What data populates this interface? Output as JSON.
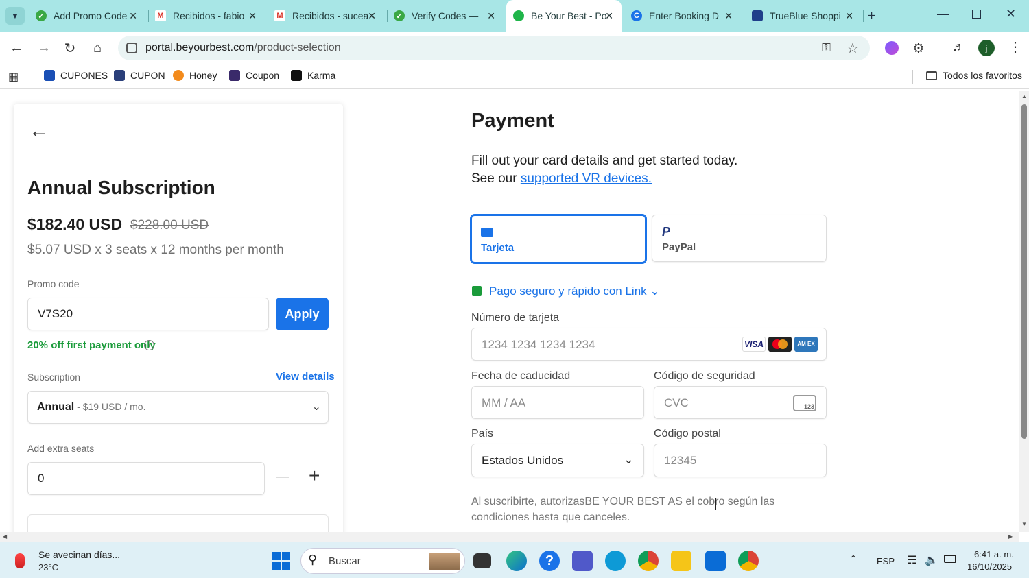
{
  "browser": {
    "tabs": [
      {
        "label": "Add Promo Code",
        "color": "#3aa845"
      },
      {
        "label": "Recibidos - fabio",
        "color": "#d93025"
      },
      {
        "label": "Recibidos - sucea",
        "color": "#d93025"
      },
      {
        "label": "Verify Codes — ",
        "color": "#3aa845"
      },
      {
        "label": "Be Your Best - Po",
        "color": "#3aa845",
        "active": true
      },
      {
        "label": "Enter Booking D",
        "color": "#1a73e8"
      },
      {
        "label": "TrueBlue Shoppi",
        "color": "#1f3f8a"
      }
    ],
    "url_domain": "portal.beyourbest.com",
    "url_path": "/product-selection",
    "bookmarks": [
      "CUPONES",
      "CUPON",
      "Honey",
      "Coupon",
      "Karma"
    ],
    "all_favorites": "Todos los favoritos"
  },
  "left": {
    "title": "Annual Subscription",
    "price": "$182.40 USD",
    "old_price": "$228.00 USD",
    "breakdown": "$5.07 USD x 3 seats x 12 months per month",
    "promo_label": "Promo code",
    "promo_value": "V7S20",
    "apply_label": "Apply",
    "promo_note": "20% off first payment only",
    "subscription_label": "Subscription",
    "view_details": "View details",
    "plan_name": "Annual",
    "plan_price": " - $19 USD / mo.",
    "seats_label": "Add extra seats",
    "seats_value": "0",
    "minus": "—",
    "plus": "+"
  },
  "payment": {
    "title": "Payment",
    "subtitle1": "Fill out your card details and get started today.",
    "subtitle2_prefix": "See our ",
    "subtitle2_link": "supported VR devices.",
    "method_card": "Tarjeta",
    "method_paypal": "PayPal",
    "link_text": "Pago seguro y rápido con Link",
    "card_label": "Número de tarjeta",
    "card_placeholder": "1234 1234 1234 1234",
    "expiry_label": "Fecha de caducidad",
    "expiry_placeholder": "MM / AA",
    "cvc_label": "Código de seguridad",
    "cvc_placeholder": "CVC",
    "cvc_badge": "123",
    "country_label": "País",
    "country_value": "Estados Unidos",
    "zip_label": "Código postal",
    "zip_placeholder": "12345",
    "terms": "Al suscribirte, autorizasBE YOUR BEST AS el cobro según las condiciones hasta que canceles.",
    "visa": "VISA",
    "amex": "AM EX"
  },
  "taskbar": {
    "weather_title": "Se avecinan días...",
    "weather_temp": "23°C",
    "search_label": "Buscar",
    "lang": "ESP",
    "time": "6:41 a. m.",
    "date": "16/10/2025"
  },
  "colors": {
    "accent": "#1a73e8",
    "tabbar": "#a8e6e6",
    "green": "#1a9b3a"
  }
}
